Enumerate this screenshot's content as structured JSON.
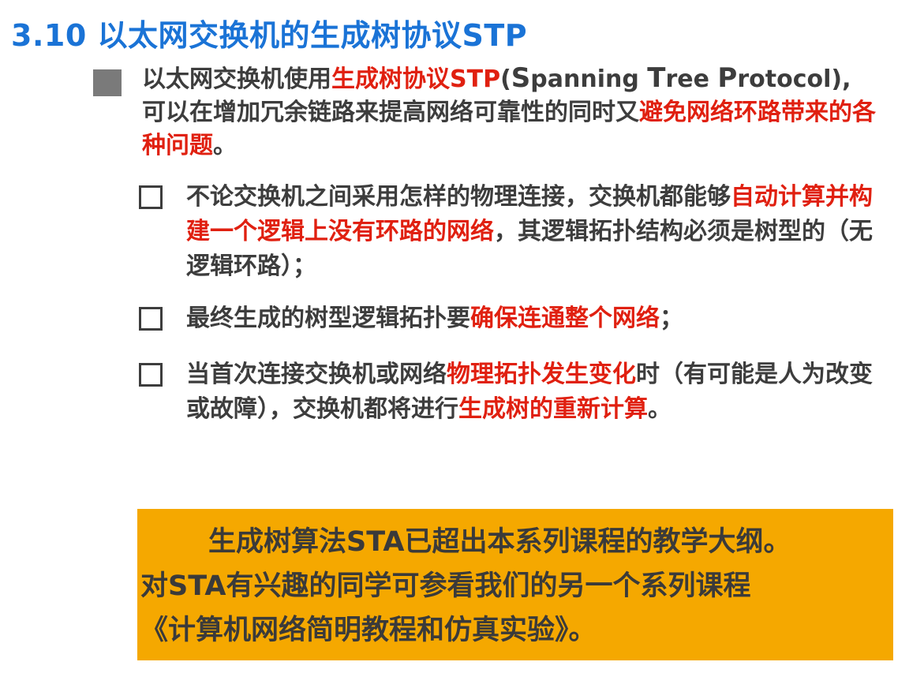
{
  "title": "3.10 以太网交换机的生成树协议STP",
  "intro": {
    "p1": "以太网交换机使用",
    "p2_red": "生成树协议STP",
    "p3": "(",
    "p4": "S",
    "p5": "panning ",
    "p6": "T",
    "p7": "ree ",
    "p8": "P",
    "p9": "rotocol),",
    "p10": "可以在增加冗余链路来提高网络可靠性的同时又",
    "p11_red": "避免网络环路带来的各种问题",
    "p12": "。"
  },
  "items": [
    {
      "a": "不论交换机之间采用怎样的物理连接，交换机都能够",
      "b_red": "自动计算并构建一个逻辑上没有环路的网络",
      "c": "，其逻辑拓扑结构必须是树型的（无逻辑环路）；"
    },
    {
      "a": "最终生成的树型逻辑拓扑要",
      "b_red": "确保连通整个网络",
      "c": "；"
    },
    {
      "a": "当首次连接交换机或网络",
      "b_red": "物理拓扑发生变化",
      "c": "时（有可能是人为改变或故障），交换机都将进行",
      "d_red": "生成树的重新计算",
      "e": "。"
    }
  ],
  "note": {
    "line1": "生成树算法STA已超出本系列课程的教学大纲。",
    "line2": "对STA有兴趣的同学可参看我们的另一个系列课程",
    "line3": "《计算机网络简明教程和仿真实验》。"
  },
  "colors": {
    "title": "#1a73d6",
    "highlight": "#e02010",
    "text": "#3d3d3d",
    "note_bg": "#f5a800"
  }
}
